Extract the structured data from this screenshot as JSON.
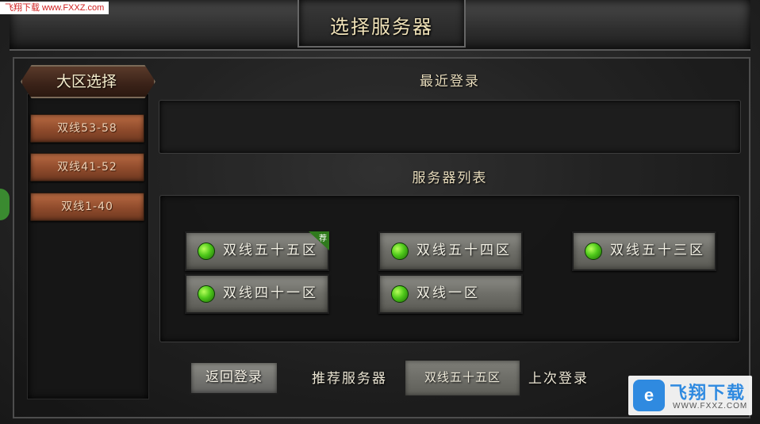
{
  "watermark_top": "飞翔下载 www.FXXZ.com",
  "window": {
    "title": "选择服务器"
  },
  "sidebar": {
    "title": "大区选择",
    "regions": [
      "双线53-58",
      "双线41-52",
      "双线1-40"
    ]
  },
  "main": {
    "recent_heading": "最近登录",
    "list_heading": "服务器列表",
    "servers": [
      {
        "name": "双线五十五区",
        "status": "green",
        "recommended": true,
        "tag": "荐"
      },
      {
        "name": "双线五十四区",
        "status": "green"
      },
      {
        "name": "双线五十三区",
        "status": "green"
      },
      {
        "name": "双线四十一区",
        "status": "green"
      },
      {
        "name": "双线一区",
        "status": "green"
      }
    ]
  },
  "footer": {
    "back_label": "返回登录",
    "recommend_label": "推荐服务器",
    "recommend_server": "双线五十五区",
    "last_login_label": "上次登录"
  },
  "watermark_bottom": {
    "logo": "e",
    "title": "飞翔下载",
    "url": "WWW.FXXZ.COM"
  },
  "colors": {
    "status_green": "#4ec81a",
    "region_button": "#8f4b2c",
    "title_text": "#f0e2b8"
  }
}
